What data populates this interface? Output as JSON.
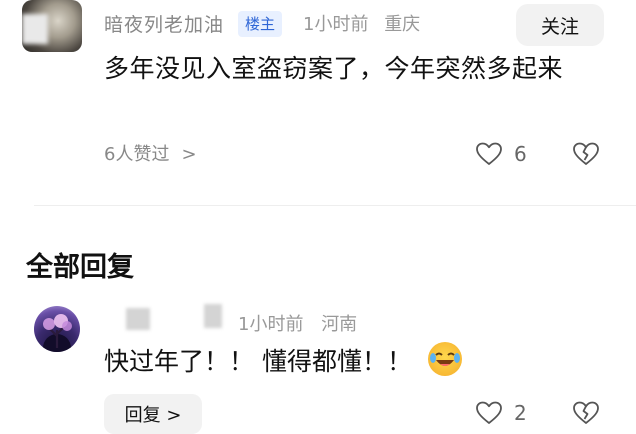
{
  "top_comment": {
    "username": "暗夜列老加油",
    "badge": "楼主",
    "time": "1小时前",
    "location": "重庆",
    "follow_label": "关注",
    "content": "多年没见入室盗窃案了，今年突然多起来",
    "likers_text": "6人赞过",
    "likers_chevron": ">",
    "like_count": "6",
    "like_icon": "heart-icon",
    "dislike_icon": "broken-heart-icon"
  },
  "section_title": "全部回复",
  "reply": {
    "username": "",
    "time": "1小时前",
    "location": "河南",
    "content": "快过年了！！ 懂得都懂！！",
    "emoji": "laughing-tears-emoji",
    "reply_label": "回复 >",
    "like_count": "2",
    "like_icon": "heart-icon",
    "dislike_icon": "broken-heart-icon"
  },
  "colors": {
    "badge_bg": "#e8f0ff",
    "badge_text": "#2f66d6",
    "meta_text": "#999999",
    "button_bg": "#f2f2f2"
  }
}
